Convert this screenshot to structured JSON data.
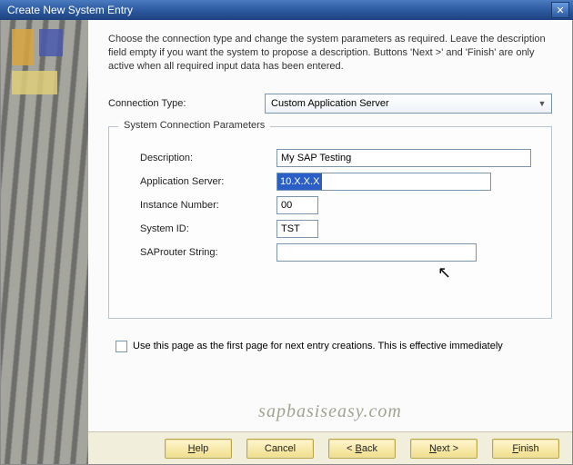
{
  "titlebar": {
    "title": "Create New System Entry"
  },
  "intro": "Choose the connection type and change the system parameters as required. Leave the description field empty if you want the system to propose a description. Buttons 'Next >' and 'Finish' are only active when all required input data has been entered.",
  "connection": {
    "label": "Connection Type:",
    "selected": "Custom Application Server"
  },
  "group": {
    "title": "System Connection Parameters",
    "fields": {
      "description": {
        "label": "Description:",
        "value": "My SAP Testing"
      },
      "appserver": {
        "label": "Application Server:",
        "value": "10.X.X.X"
      },
      "instance": {
        "label": "Instance Number:",
        "value": "00"
      },
      "systemid": {
        "label": "System ID:",
        "value": "TST"
      },
      "saprouter": {
        "label": "SAProuter String:",
        "value": ""
      }
    }
  },
  "checkbox": {
    "label": "Use this page as the first page for next entry creations. This is effective immediately",
    "checked": false
  },
  "watermark": "sapbasiseasy.com",
  "buttons": {
    "help": "Help",
    "cancel": "Cancel",
    "back": "< Back",
    "next": "Next >",
    "finish": "Finish"
  }
}
